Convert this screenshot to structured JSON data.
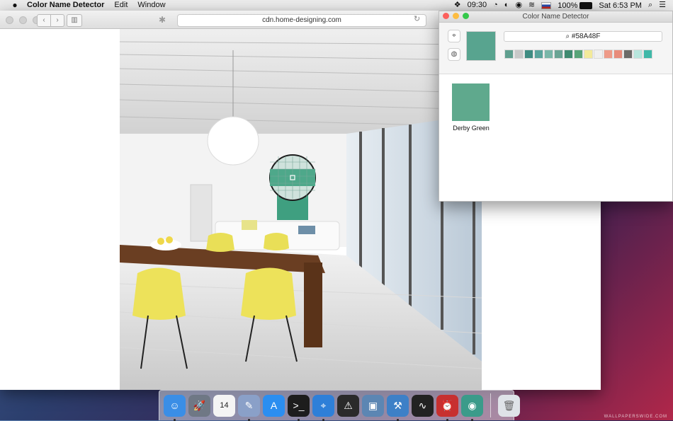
{
  "menubar": {
    "apple_icon": "apple-icon",
    "app_name": "Color Name Detector",
    "menus": [
      "Edit",
      "Window"
    ],
    "clock": "09:30",
    "battery": "100%",
    "datetime": "Sat 6:53 PM"
  },
  "browser": {
    "url": "cdn.home-designing.com"
  },
  "detector": {
    "title": "Color Name Detector",
    "current_hex": "#58A48F",
    "current_color": "#58A48F",
    "history_colors": [
      "#5f9f8f",
      "#c8c8c8",
      "#3f8c82",
      "#5aa49c",
      "#79b6a8",
      "#6aa494",
      "#3f8a70",
      "#58a478",
      "#f3ea9a",
      "#efefef",
      "#ee9a88",
      "#e88b7a",
      "#6b6b68",
      "#b7e6dd",
      "#3fb8a8"
    ],
    "result": {
      "name": "Derby Green",
      "color": "#5FA98D"
    }
  },
  "dock": {
    "apps": [
      {
        "name": "finder",
        "color": "#3a8ee6",
        "glyph": "☺",
        "running": true
      },
      {
        "name": "launchpad",
        "color": "#6f7885",
        "glyph": "🚀",
        "running": false
      },
      {
        "name": "calendar",
        "color": "#f4f4f4",
        "glyph": "14",
        "running": false
      },
      {
        "name": "preview",
        "color": "#8aa0c8",
        "glyph": "✎",
        "running": true
      },
      {
        "name": "app-store",
        "color": "#2b8ef0",
        "glyph": "A",
        "running": false
      },
      {
        "name": "terminal",
        "color": "#1d1d1d",
        "glyph": ">_",
        "running": true
      },
      {
        "name": "safari",
        "color": "#2e7fd8",
        "glyph": "⌖",
        "running": true
      },
      {
        "name": "console",
        "color": "#2a2a2a",
        "glyph": "⚠",
        "running": false
      },
      {
        "name": "image-viewer",
        "color": "#5c86b3",
        "glyph": "▣",
        "running": false
      },
      {
        "name": "xcode",
        "color": "#3d80c7",
        "glyph": "⚒",
        "running": true
      },
      {
        "name": "activity-monitor",
        "color": "#222",
        "glyph": "∿",
        "running": false
      },
      {
        "name": "clock",
        "color": "#c73030",
        "glyph": "⏰",
        "running": true
      },
      {
        "name": "color-name-detector",
        "color": "#3b9b8a",
        "glyph": "◉",
        "running": true
      }
    ],
    "trash": {
      "name": "trash",
      "color": "#dfe3e8",
      "glyph": "🗑"
    }
  }
}
